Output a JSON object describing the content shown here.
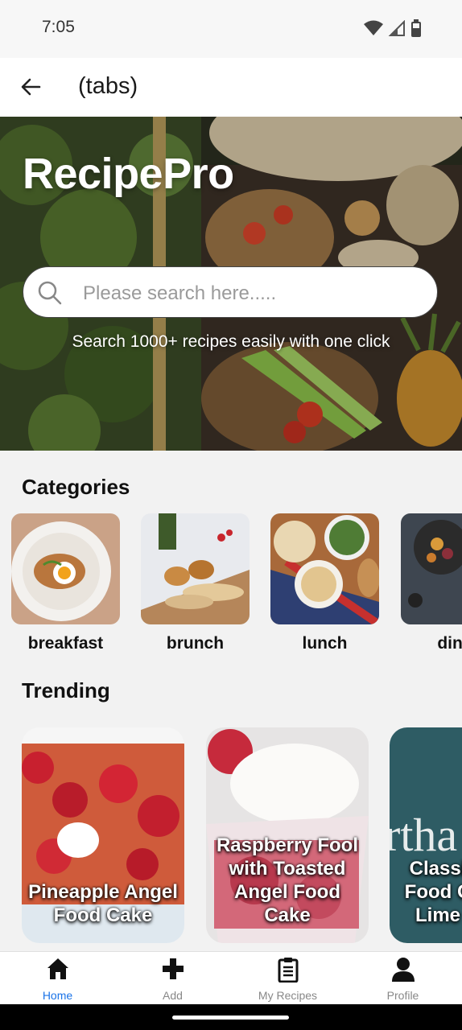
{
  "status_bar": {
    "time": "7:05"
  },
  "app_bar": {
    "title": "(tabs)"
  },
  "hero": {
    "title": "RecipePro",
    "search_placeholder": "Please search here.....",
    "subtitle": "Search 1000+ recipes easily with one click"
  },
  "categories": {
    "title": "Categories",
    "items": [
      {
        "label": "breakfast"
      },
      {
        "label": "brunch"
      },
      {
        "label": "lunch"
      },
      {
        "label": "dinn"
      }
    ]
  },
  "trending": {
    "title": "Trending",
    "items": [
      {
        "label": "Pineapple Angel Food Cake"
      },
      {
        "label": "Raspberry Fool with Toasted Angel Food Cake"
      },
      {
        "label": "Classi Food C Lime"
      }
    ],
    "card3_overlay_text": "rtha"
  },
  "bottom_nav": {
    "items": [
      {
        "label": "Home",
        "icon": "home-icon",
        "active": true
      },
      {
        "label": "Add",
        "icon": "plus-icon",
        "active": false
      },
      {
        "label": "My Recipes",
        "icon": "clipboard-icon",
        "active": false
      },
      {
        "label": "Profile",
        "icon": "user-icon",
        "active": false
      }
    ]
  },
  "colors": {
    "active": "#1a73e8",
    "inactive": "#888888",
    "hero_text": "#ffffff"
  }
}
